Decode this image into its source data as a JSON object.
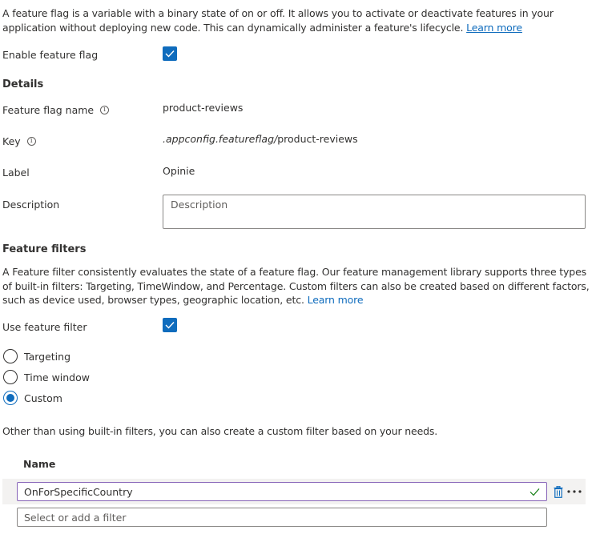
{
  "intro": {
    "text": "A feature flag is a variable with a binary state of on or off. It allows you to activate or deactivate features in your application without deploying new code. This can dynamically administer a feature's lifecycle.",
    "learn_more": "Learn more"
  },
  "enable_flag": {
    "label": "Enable feature flag",
    "checked": true
  },
  "details": {
    "title": "Details",
    "name_label": "Feature flag name",
    "name_value": "product-reviews",
    "key_label": "Key",
    "key_prefix": ".appconfig.featureflag/",
    "key_value": "product-reviews",
    "label_label": "Label",
    "label_value": "Opinie",
    "description_label": "Description",
    "description_placeholder": "Description"
  },
  "feature_filters": {
    "title": "Feature filters",
    "text": "A Feature filter consistently evaluates the state of a feature flag. Our feature management library supports three types of built-in filters: Targeting, TimeWindow, and Percentage. Custom filters can also be created based on different factors, such as device used, browser types, geographic location, etc.",
    "learn_more": "Learn more",
    "use_label": "Use feature filter",
    "use_checked": true,
    "options": [
      {
        "label": "Targeting",
        "selected": false
      },
      {
        "label": "Time window",
        "selected": false
      },
      {
        "label": "Custom",
        "selected": true
      }
    ],
    "custom_note": "Other than using built-in filters, you can also create a custom filter based on your needs.",
    "table_header": "Name",
    "filter_value": "OnForSpecificCountry",
    "add_placeholder": "Select or add a filter"
  },
  "colors": {
    "accent": "#0f6cbd",
    "valid": "#107c10",
    "focus_border": "#8764b8"
  },
  "icons": {
    "checkbox": "checkmark-icon",
    "info": "info-icon",
    "valid": "valid-checkmark-icon",
    "delete": "trash-icon",
    "more": "more-options-icon"
  }
}
